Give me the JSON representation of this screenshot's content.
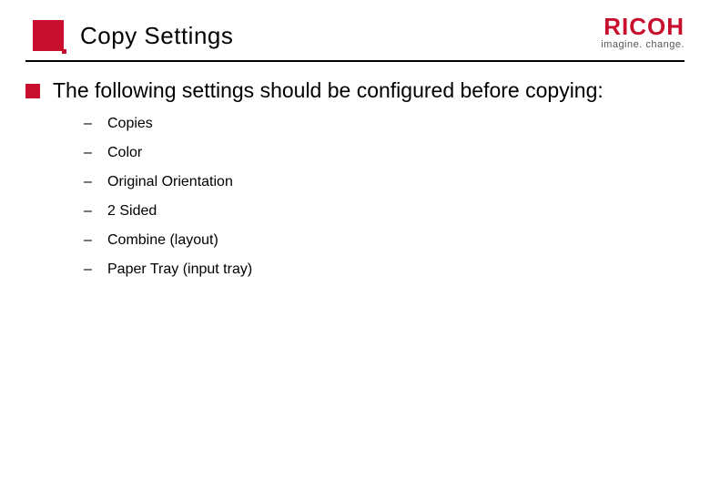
{
  "header": {
    "title": "Copy Settings",
    "logo": "RICOH",
    "tagline": "imagine. change."
  },
  "content": {
    "intro": "The following settings should be configured before copying:",
    "items": [
      "Copies",
      "Color",
      "Original Orientation",
      "2 Sided",
      "Combine (layout)",
      "Paper Tray (input tray)"
    ]
  },
  "colors": {
    "accent": "#c8102e"
  }
}
